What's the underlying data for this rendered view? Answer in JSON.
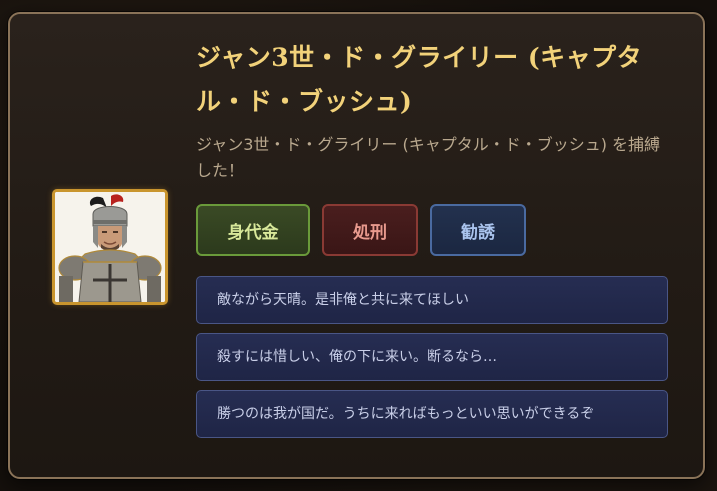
{
  "captive": {
    "name_title": "ジャン3世・ド・グライリー (キャプタル・ド・ブッシュ)",
    "message": "ジャン3世・ド・グライリー (キャプタル・ド・ブッシュ) を捕縛した！"
  },
  "actions": {
    "ransom_label": "身代金",
    "execute_label": "処刑",
    "recruit_label": "勧誘"
  },
  "dialogue_options": [
    "敵ながら天晴。是非俺と共に来てほしい",
    "殺すには惜しい、俺の下に来い。断るなら…",
    "勝つのは我が国だ。うちに来ればもっといい思いができるぞ"
  ]
}
